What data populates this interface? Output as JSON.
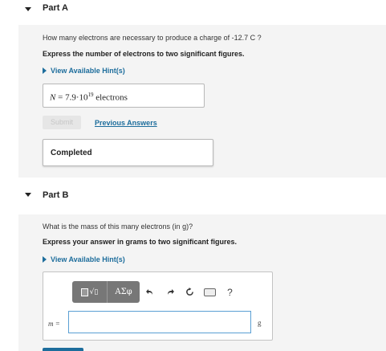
{
  "partA": {
    "title": "Part A",
    "question": "How many electrons are necessary to produce a charge of -12.7 C ?",
    "instruction": "Express the number of electrons to two significant figures.",
    "hint_label": "View Available Hint(s)",
    "answer": {
      "variable": "N",
      "equals": " = ",
      "mantissa": "7.9·10",
      "exponent": "19",
      "unit": " electrons"
    },
    "submit_label": "Submit",
    "previous_answers_label": "Previous Answers",
    "status": "Completed"
  },
  "partB": {
    "title": "Part B",
    "question": "What is the mass of this many electrons (in g)?",
    "instruction": "Express your answer in grams to two significant figures.",
    "hint_label": "View Available Hint(s)",
    "toolbar": {
      "templates_icon": "templates-icon",
      "greek_label": "ΑΣφ",
      "undo_icon": "undo-icon",
      "redo_icon": "redo-icon",
      "reset_icon": "reset-icon",
      "keyboard_icon": "keyboard-icon",
      "help_label": "?"
    },
    "input_label": "m =",
    "input_value": "",
    "unit": "g"
  },
  "colors": {
    "link": "#1d6d9c",
    "panel_bg": "#f4f4f4",
    "toolbar_bg": "#777777",
    "input_focus_border": "#5a9fd4"
  }
}
